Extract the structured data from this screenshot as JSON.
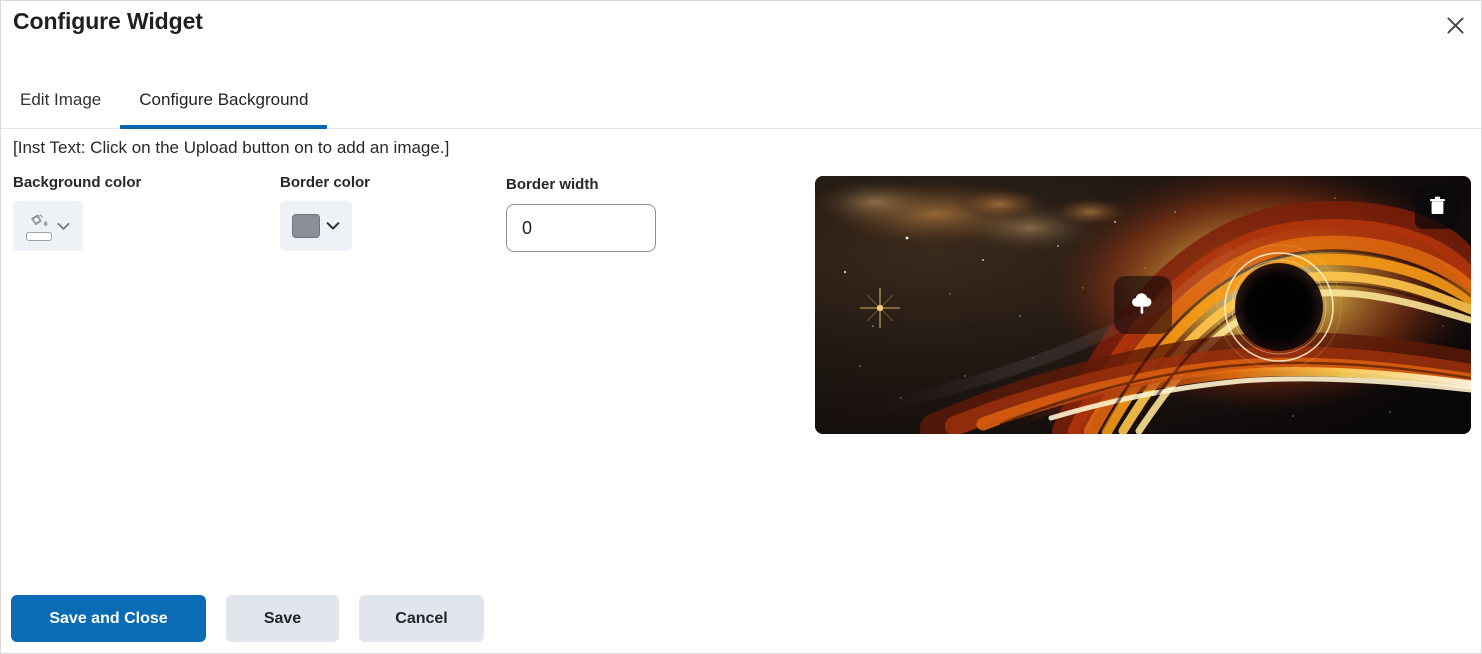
{
  "dialog": {
    "title": "Configure Widget",
    "close_icon": "close-icon"
  },
  "tabs": [
    {
      "label": "Edit Image",
      "active": false
    },
    {
      "label": "Configure Background",
      "active": true
    }
  ],
  "instruction": "[Inst Text: Click on the Upload button on to add an image.]",
  "form": {
    "background_color": {
      "label": "Background color",
      "icon": "paint-bucket-icon",
      "value": "",
      "chevron": "chevron-down-icon"
    },
    "border_color": {
      "label": "Border color",
      "swatch_color": "#8b9096",
      "chevron": "chevron-down-icon"
    },
    "border_width": {
      "label": "Border width",
      "value": "0",
      "placeholder": "0"
    }
  },
  "image_preview": {
    "alt": "black hole accretion disk image",
    "delete_icon": "trash-icon",
    "upload_icon": "cloud-upload-icon"
  },
  "footer": {
    "save_and_close": "Save and Close",
    "save": "Save",
    "cancel": "Cancel"
  },
  "colors": {
    "accent": "#0466b0",
    "primary_button": "#0a6cb4",
    "secondary_button": "#e1e6ed",
    "picker_background": "#eef1f6",
    "text": "#26282a"
  }
}
